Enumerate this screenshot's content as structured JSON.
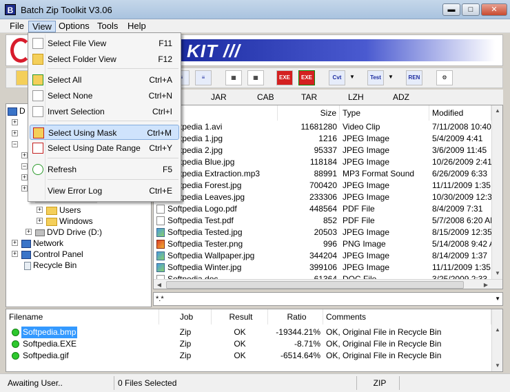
{
  "window": {
    "title": "Batch Zip Toolkit V3.06",
    "app_icon": "B"
  },
  "menubar": {
    "file": "File",
    "view": "View",
    "options": "Options",
    "tools": "Tools",
    "help": "Help"
  },
  "banner": {
    "text": "KIT ///"
  },
  "toolbar": {
    "exe1": "EXE",
    "exe2": "EXE",
    "cvt": "Cvt",
    "test": "Test",
    "ren": "REN"
  },
  "formats": [
    "JAR",
    "CAB",
    "TAR",
    "LZH",
    "ADZ"
  ],
  "view_menu": [
    {
      "label": "Select File View",
      "shortcut": "F11"
    },
    {
      "label": "Select Folder View",
      "shortcut": "F12"
    },
    {
      "label": "Select All",
      "shortcut": "Ctrl+A"
    },
    {
      "label": "Select None",
      "shortcut": "Ctrl+N"
    },
    {
      "label": "Invert Selection",
      "shortcut": "Ctrl+I"
    },
    {
      "label": "Select Using Mask",
      "shortcut": "Ctrl+M"
    },
    {
      "label": "Select Using Date Range",
      "shortcut": "Ctrl+Y"
    },
    {
      "label": "Refresh",
      "shortcut": "F5"
    },
    {
      "label": "View Error Log",
      "shortcut": "Ctrl+E"
    }
  ],
  "tree": {
    "root": "D",
    "users": "Users",
    "windows": "Windows",
    "dvd": "DVD Drive (D:)",
    "network": "Network",
    "control_panel": "Control Panel",
    "recycle_bin": "Recycle Bin"
  },
  "file_list": {
    "columns": {
      "size": "Size",
      "type": "Type",
      "modified": "Modified"
    },
    "rows": [
      {
        "name": "Softpedia 1.avi",
        "size": "11681280",
        "type": "Video Clip",
        "modified": "7/11/2008 10:40",
        "icon": "doc"
      },
      {
        "name": "Softpedia 1.jpg",
        "size": "1216",
        "type": "JPEG Image",
        "modified": "5/4/2009 4:41",
        "icon": "img"
      },
      {
        "name": "Softpedia 2.jpg",
        "size": "95337",
        "type": "JPEG Image",
        "modified": "3/6/2009 11:45",
        "icon": "img"
      },
      {
        "name": "Softpedia Blue.jpg",
        "size": "118184",
        "type": "JPEG Image",
        "modified": "10/26/2009 2:41",
        "icon": "img"
      },
      {
        "name": "Softpedia Extraction.mp3",
        "size": "88991",
        "type": "MP3 Format Sound",
        "modified": "6/26/2009 6:33",
        "icon": "doc"
      },
      {
        "name": "Softpedia Forest.jpg",
        "size": "700420",
        "type": "JPEG Image",
        "modified": "11/11/2009 1:35",
        "icon": "img"
      },
      {
        "name": "Softpedia Leaves.jpg",
        "size": "233306",
        "type": "JPEG Image",
        "modified": "10/30/2009 12:35",
        "icon": "img"
      },
      {
        "name": "Softpedia Logo.pdf",
        "size": "448564",
        "type": "PDF File",
        "modified": "8/4/2009 7:31",
        "icon": "doc"
      },
      {
        "name": "Softpedia Test.pdf",
        "size": "852",
        "type": "PDF File",
        "modified": "5/7/2008 6:20 AM",
        "icon": "doc"
      },
      {
        "name": "Softpedia Tested.jpg",
        "size": "20503",
        "type": "JPEG Image",
        "modified": "8/15/2009 12:35",
        "icon": "img"
      },
      {
        "name": "Softpedia Tester.png",
        "size": "996",
        "type": "PNG Image",
        "modified": "5/14/2008 9:42 A",
        "icon": "png"
      },
      {
        "name": "Softpedia Wallpaper.jpg",
        "size": "344204",
        "type": "JPEG Image",
        "modified": "8/14/2009 1:37",
        "icon": "img"
      },
      {
        "name": "Softpedia Winter.jpg",
        "size": "399106",
        "type": "JPEG Image",
        "modified": "11/11/2009 1:35",
        "icon": "img"
      },
      {
        "name": "Softpedia.doc",
        "size": "61364",
        "type": "DOC File",
        "modified": "3/25/2009 2:33",
        "icon": "doc"
      }
    ]
  },
  "mask_field": {
    "value": "*.*"
  },
  "jobs": {
    "columns": {
      "filename": "Filename",
      "job": "Job",
      "result": "Result",
      "ratio": "Ratio",
      "comments": "Comments"
    },
    "rows": [
      {
        "filename": "Softpedia.bmp",
        "job": "Zip",
        "result": "OK",
        "ratio": "-19344.21%",
        "comments": "OK, Original File in Recycle Bin"
      },
      {
        "filename": "Softpedia.EXE",
        "job": "Zip",
        "result": "OK",
        "ratio": "-8.71%",
        "comments": "OK, Original File in Recycle Bin"
      },
      {
        "filename": "Softpedia.gif",
        "job": "Zip",
        "result": "OK",
        "ratio": "-6514.64%",
        "comments": "OK, Original File in Recycle Bin"
      }
    ]
  },
  "status": {
    "state": "Awaiting User..",
    "selection": "0 Files Selected",
    "format": "ZIP"
  }
}
